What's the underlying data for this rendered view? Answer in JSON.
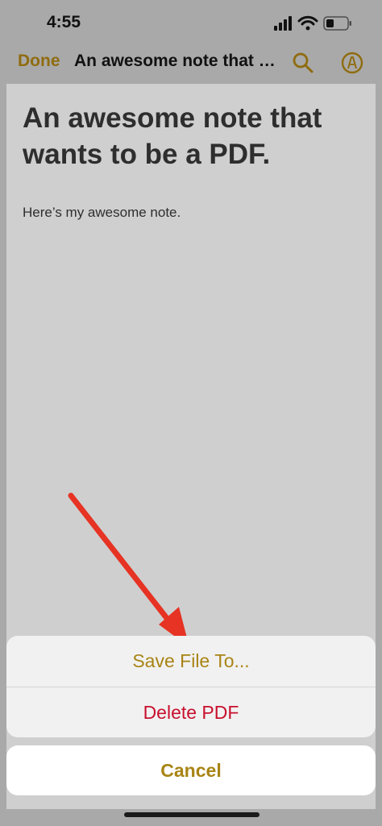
{
  "status_bar": {
    "time": "4:55",
    "icons": [
      "cellular-signal-icon",
      "wifi-icon",
      "battery-icon"
    ]
  },
  "nav_bar": {
    "done_label": "Done",
    "title": "An awesome note that wants to be a PDF.",
    "icons": [
      "search-icon",
      "markup-pen-icon"
    ]
  },
  "document": {
    "title": "An awesome note that wants to be a PDF.",
    "body": "Here’s my awesome note."
  },
  "action_sheet": {
    "save_label": "Save File To...",
    "delete_label": "Delete PDF",
    "cancel_label": "Cancel"
  },
  "colors": {
    "accent": "#a88414",
    "destructive": "#c8102e",
    "annotation_arrow": "#e63323"
  }
}
